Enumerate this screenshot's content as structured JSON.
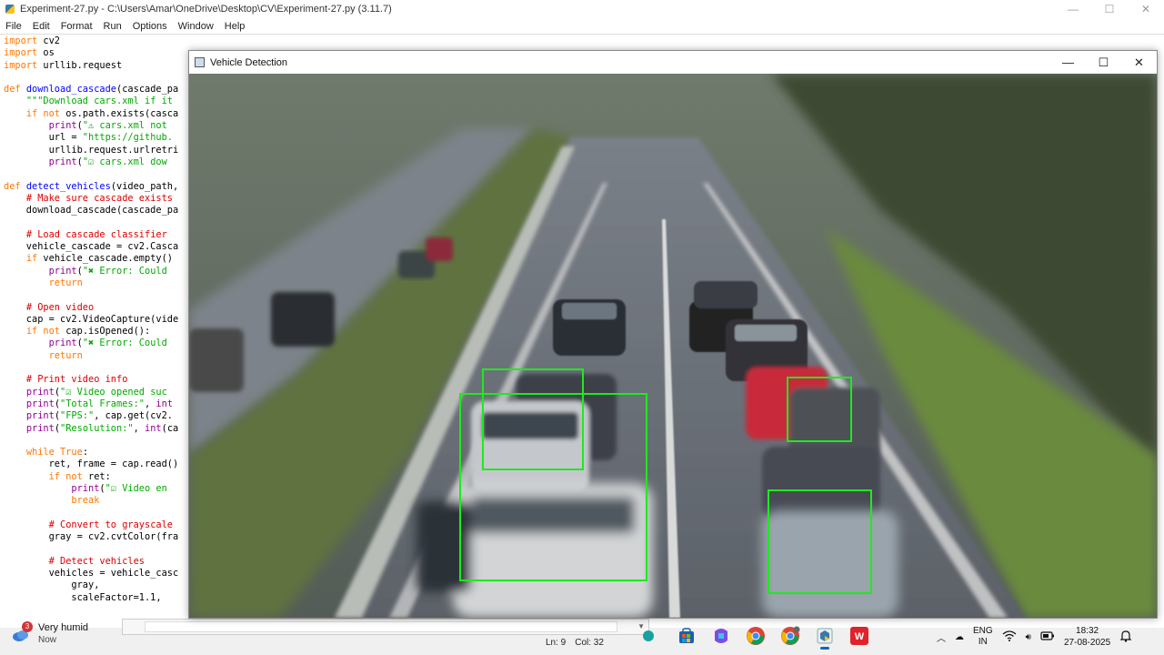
{
  "idle": {
    "title": "Experiment-27.py - C:\\Users\\Amar\\OneDrive\\Desktop\\CV\\Experiment-27.py (3.11.7)",
    "menu": [
      "File",
      "Edit",
      "Format",
      "Run",
      "Options",
      "Window",
      "Help"
    ],
    "status": {
      "ln": "Ln: 9",
      "col": "Col: 32"
    }
  },
  "code_lines": [
    [
      [
        "kw",
        "import"
      ],
      [
        "t",
        " cv2"
      ]
    ],
    [
      [
        "kw",
        "import"
      ],
      [
        "t",
        " os"
      ]
    ],
    [
      [
        "kw",
        "import"
      ],
      [
        "t",
        " urllib.request"
      ]
    ],
    [],
    [
      [
        "kw",
        "def"
      ],
      [
        "t",
        " "
      ],
      [
        "fn",
        "download_cascade"
      ],
      [
        "t",
        "(cascade_pa"
      ]
    ],
    [
      [
        "t",
        "    "
      ],
      [
        "str",
        "\"\"\"Download cars.xml if it"
      ]
    ],
    [
      [
        "t",
        "    "
      ],
      [
        "kw",
        "if not"
      ],
      [
        "t",
        " os.path.exists(casca"
      ]
    ],
    [
      [
        "t",
        "        "
      ],
      [
        "bi",
        "print"
      ],
      [
        "t",
        "("
      ],
      [
        "str",
        "\"⚠ cars.xml not"
      ]
    ],
    [
      [
        "t",
        "        url = "
      ],
      [
        "str",
        "\"https://github."
      ]
    ],
    [
      [
        "t",
        "        urllib.request.urlretri"
      ]
    ],
    [
      [
        "t",
        "        "
      ],
      [
        "bi",
        "print"
      ],
      [
        "t",
        "("
      ],
      [
        "str",
        "\"☑ cars.xml dow"
      ]
    ],
    [],
    [
      [
        "kw",
        "def"
      ],
      [
        "t",
        " "
      ],
      [
        "fn",
        "detect_vehicles"
      ],
      [
        "t",
        "(video_path,"
      ]
    ],
    [
      [
        "t",
        "    "
      ],
      [
        "cm",
        "# Make sure cascade exists"
      ]
    ],
    [
      [
        "t",
        "    download_cascade(cascade_pa"
      ]
    ],
    [],
    [
      [
        "t",
        "    "
      ],
      [
        "cm",
        "# Load cascade classifier"
      ]
    ],
    [
      [
        "t",
        "    vehicle_cascade = cv2.Casca"
      ]
    ],
    [
      [
        "t",
        "    "
      ],
      [
        "kw",
        "if"
      ],
      [
        "t",
        " vehicle_cascade.empty()"
      ]
    ],
    [
      [
        "t",
        "        "
      ],
      [
        "bi",
        "print"
      ],
      [
        "t",
        "("
      ],
      [
        "str",
        "\"✖ Error: Could"
      ]
    ],
    [
      [
        "t",
        "        "
      ],
      [
        "kw",
        "return"
      ]
    ],
    [],
    [
      [
        "t",
        "    "
      ],
      [
        "cm",
        "# Open video"
      ]
    ],
    [
      [
        "t",
        "    cap = cv2.VideoCapture(vide"
      ]
    ],
    [
      [
        "t",
        "    "
      ],
      [
        "kw",
        "if not"
      ],
      [
        "t",
        " cap.isOpened():"
      ]
    ],
    [
      [
        "t",
        "        "
      ],
      [
        "bi",
        "print"
      ],
      [
        "t",
        "("
      ],
      [
        "str",
        "\"✖ Error: Could"
      ]
    ],
    [
      [
        "t",
        "        "
      ],
      [
        "kw",
        "return"
      ]
    ],
    [],
    [
      [
        "t",
        "    "
      ],
      [
        "cm",
        "# Print video info"
      ]
    ],
    [
      [
        "t",
        "    "
      ],
      [
        "bi",
        "print"
      ],
      [
        "t",
        "("
      ],
      [
        "str",
        "\"☑ Video opened suc"
      ]
    ],
    [
      [
        "t",
        "    "
      ],
      [
        "bi",
        "print"
      ],
      [
        "t",
        "("
      ],
      [
        "str",
        "\"Total Frames:\""
      ],
      [
        "t",
        ", "
      ],
      [
        "bi",
        "int"
      ]
    ],
    [
      [
        "t",
        "    "
      ],
      [
        "bi",
        "print"
      ],
      [
        "t",
        "("
      ],
      [
        "str",
        "\"FPS:\""
      ],
      [
        "t",
        ", cap.get(cv2."
      ]
    ],
    [
      [
        "t",
        "    "
      ],
      [
        "bi",
        "print"
      ],
      [
        "t",
        "("
      ],
      [
        "str",
        "\"Resolution:\""
      ],
      [
        "t",
        ", "
      ],
      [
        "bi",
        "int"
      ],
      [
        "t",
        "(ca"
      ]
    ],
    [],
    [
      [
        "t",
        "    "
      ],
      [
        "kw",
        "while"
      ],
      [
        "t",
        " "
      ],
      [
        "kw",
        "True"
      ],
      [
        "t",
        ":"
      ]
    ],
    [
      [
        "t",
        "        ret, frame = cap.read()"
      ]
    ],
    [
      [
        "t",
        "        "
      ],
      [
        "kw",
        "if not"
      ],
      [
        "t",
        " ret:"
      ]
    ],
    [
      [
        "t",
        "            "
      ],
      [
        "bi",
        "print"
      ],
      [
        "t",
        "("
      ],
      [
        "str",
        "\"☑ Video en"
      ]
    ],
    [
      [
        "t",
        "            "
      ],
      [
        "kw",
        "break"
      ]
    ],
    [],
    [
      [
        "t",
        "        "
      ],
      [
        "cm",
        "# Convert to grayscale"
      ]
    ],
    [
      [
        "t",
        "        gray = cv2.cvtColor(fra"
      ]
    ],
    [],
    [
      [
        "t",
        "        "
      ],
      [
        "cm",
        "# Detect vehicles"
      ]
    ],
    [
      [
        "t",
        "        vehicles = vehicle_casc"
      ]
    ],
    [
      [
        "t",
        "            gray,"
      ]
    ],
    [
      [
        "t",
        "            scaleFactor=1.1,"
      ]
    ]
  ],
  "vd": {
    "title": "Vehicle Detection",
    "minimize": "—",
    "maximize": "☐",
    "close": "✕",
    "box_color": "#1eea1e"
  },
  "taskbar": {
    "weather_badge": "3",
    "weather_title": "Very humid",
    "weather_sub": "Now",
    "lang_top": "ENG",
    "lang_bottom": "IN",
    "time": "18:32",
    "date": "27-08-2025"
  }
}
